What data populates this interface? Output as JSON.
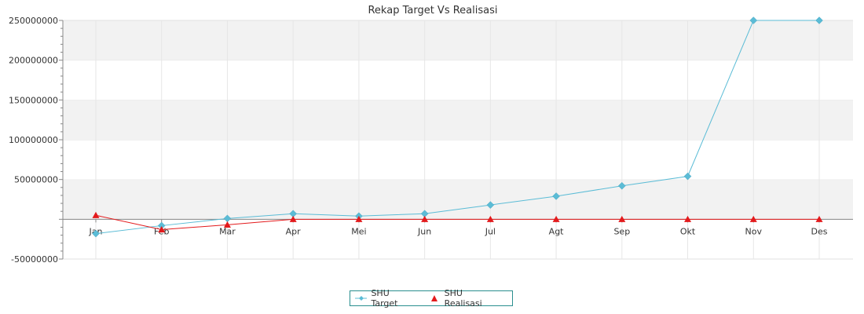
{
  "chart_data": {
    "type": "line",
    "title": "Rekap Target Vs Realisasi",
    "categories": [
      "Jan",
      "Feb",
      "Mar",
      "Apr",
      "Mei",
      "Jun",
      "Jul",
      "Agt",
      "Sep",
      "Okt",
      "Nov",
      "Des"
    ],
    "ylim": [
      -50000000,
      250000000
    ],
    "yticks": [
      -50000000,
      50000000,
      100000000,
      150000000,
      200000000,
      250000000
    ],
    "ytick_labels": [
      "-50000000",
      "50000000",
      "100000000",
      "150000000",
      "200000000",
      "250000000"
    ],
    "grid": true,
    "legend_position": "bottom",
    "series": [
      {
        "name": "SHU Target",
        "color": "#5bbcd6",
        "marker": "diamond",
        "values": [
          -18000000,
          -8000000,
          1000000,
          7000000,
          4000000,
          7000000,
          18000000,
          29000000,
          42000000,
          54000000,
          250000000,
          250000000
        ]
      },
      {
        "name": "SHU Realisasi",
        "color": "#e31a1c",
        "marker": "triangle",
        "values": [
          5000000,
          -13000000,
          -7000000,
          0,
          0,
          0,
          0,
          0,
          0,
          0,
          0,
          0
        ]
      }
    ]
  }
}
